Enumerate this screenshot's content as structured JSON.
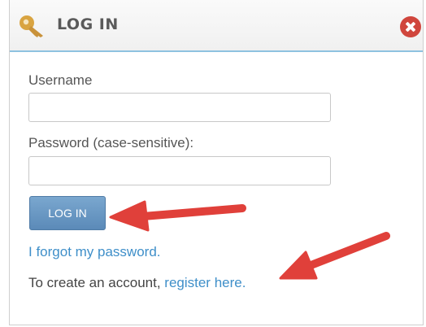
{
  "dialog": {
    "title": "LOG IN",
    "username_label": "Username",
    "username_value": "",
    "password_label": "Password (case-sensitive):",
    "password_value": "",
    "login_button_label": "LOG IN",
    "forgot_password_link": "I forgot my password.",
    "create_account_text": "To create an account, ",
    "register_link": "register here."
  },
  "icons": {
    "header_icon": "key-icon",
    "close_icon": "close-icon",
    "annotation": "arrow-icon"
  },
  "colors": {
    "accent": "#8ec2e0",
    "button": "#5b8ab8",
    "link": "#3f8fc9",
    "close": "#d0463d",
    "annotation_arrow": "#e0403a",
    "key_icon": "#d9a441"
  }
}
